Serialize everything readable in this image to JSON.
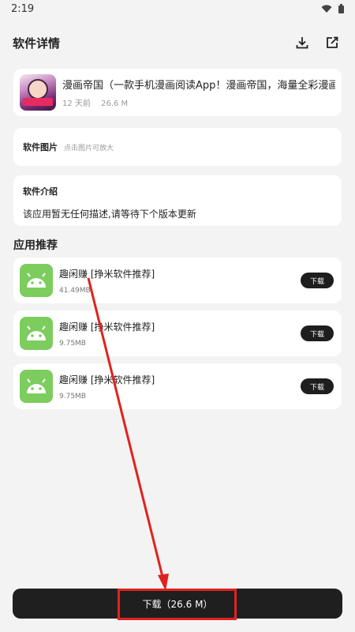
{
  "status": {
    "time": "2:19"
  },
  "header": {
    "title": "软件详情"
  },
  "app": {
    "desc": "漫画帝国（一款手机漫画阅读App！漫画帝国，海量全彩漫画资源，是",
    "age": "12 天前",
    "size": "26.6 M"
  },
  "images": {
    "label": "软件图片",
    "hint": "点击图片可放大"
  },
  "intro": {
    "title": "软件介绍",
    "text": "该应用暂无任何描述,请等待下个版本更新"
  },
  "recommend": {
    "title": "应用推荐",
    "items": [
      {
        "name": "趣闲赚 [挣米软件推荐]",
        "size": "41.49MB",
        "button": "下载"
      },
      {
        "name": "趣闲赚 [挣米软件推荐]",
        "size": "9.75MB",
        "button": "下载"
      },
      {
        "name": "趣闲赚 [挣米软件推荐]",
        "size": "9.75MB",
        "button": "下载"
      }
    ]
  },
  "download": {
    "label": "下载（26.6 M）"
  },
  "colors": {
    "accent_bar": "#1f1f1f",
    "annotation": "#e0221f",
    "android_green": "#7ccd5e"
  }
}
